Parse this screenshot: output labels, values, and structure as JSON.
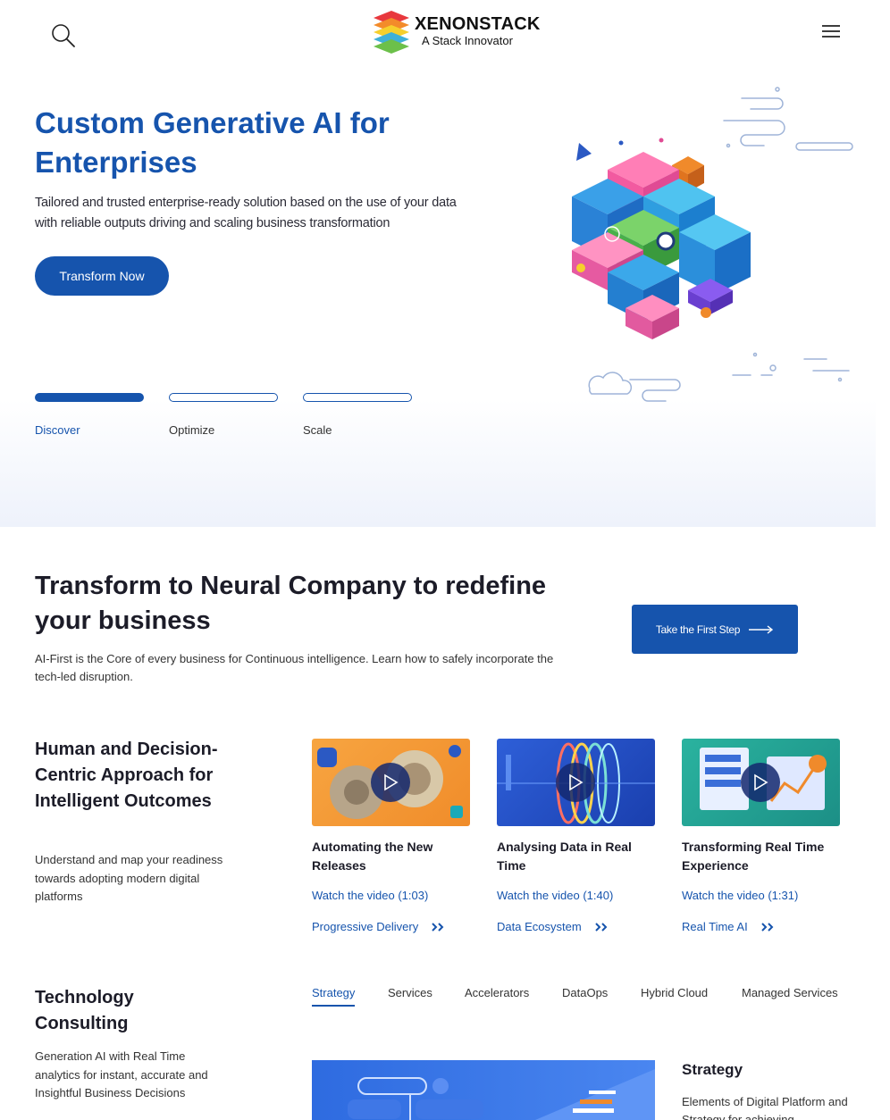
{
  "header": {
    "logo_name": "XENONSTACK",
    "logo_tagline": "A Stack Innovator",
    "icons": {
      "search": "search-icon",
      "menu": "hamburger-menu-icon"
    }
  },
  "hero": {
    "title": "Custom Generative AI for Enterprises",
    "description": "Tailored and trusted enterprise-ready solution based on the use of your data with reliable outputs driving and scaling business transformation",
    "cta_label": "Transform Now",
    "steps": [
      {
        "label": "Discover",
        "active": true
      },
      {
        "label": "Optimize",
        "active": false
      },
      {
        "label": "Scale",
        "active": false
      }
    ]
  },
  "transform": {
    "title": "Transform to Neural Company to redefine your business",
    "description": "AI-First is the Core of every business for Continuous intelligence. Learn how to safely incorporate the tech-led disruption.",
    "cta_label": "Take the First Step"
  },
  "human_centric": {
    "title": "Human and Decision-Centric Approach for Intelligent Outcomes",
    "description": "Understand and map your readiness towards adopting modern digital platforms",
    "videos": [
      {
        "title": "Automating the New Releases",
        "link": "Watch the video (1:03)",
        "topic": "Progressive Delivery"
      },
      {
        "title": "Analysing Data in Real Time",
        "link": "Watch the video (1:40)",
        "topic": "Data Ecosystem"
      },
      {
        "title": "Transforming Real Time Experience",
        "link": "Watch the video (1:31)",
        "topic": "Real Time AI"
      }
    ]
  },
  "consulting": {
    "title": "Technology Consulting",
    "description": "Generation AI with Real Time analytics for instant, accurate and Insightful Business Decisions",
    "tabs": [
      "Strategy",
      "Services",
      "Accelerators",
      "DataOps",
      "Hybrid Cloud",
      "Managed Services"
    ],
    "active_tab": "Strategy",
    "panel_title": "Strategy",
    "panel_description": "Elements of Digital Platform and Strategy for achieving"
  },
  "colors": {
    "brand_blue": "#1654ad",
    "text_dark": "#1c1c28"
  }
}
